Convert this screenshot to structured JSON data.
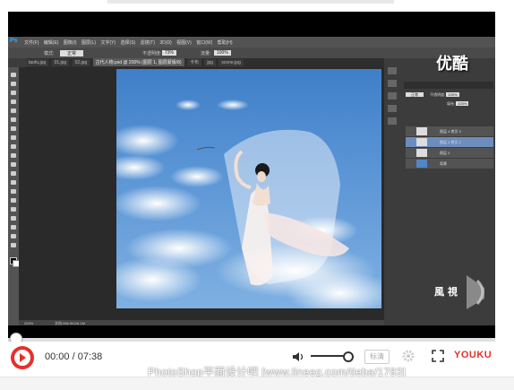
{
  "photoshop": {
    "logo": "Ps",
    "menu": [
      "文件(F)",
      "编辑(E)",
      "图像(I)",
      "图层(L)",
      "文字(Y)",
      "选择(S)",
      "滤镜(T)",
      "3D(D)",
      "视图(V)",
      "窗口(W)",
      "帮助(H)"
    ],
    "options": {
      "mode_label": "模式:",
      "mode_value": "正常",
      "opacity_label": "不透明度:",
      "opacity_value": "73%",
      "flow_label": "流量:",
      "flow_value": "100%"
    },
    "tabs": [
      "taofu.jpg",
      "01.jpg",
      "02.jpg",
      "古代人物.psd @ 200% (图层 1, 图层蒙版/8)",
      "卡布",
      "jpg",
      "scene.jpg"
    ],
    "active_tab_index": 3,
    "status": {
      "zoom": "200%",
      "doc": "文档:958.9K/16.1M"
    },
    "layers": [
      {
        "name": "图层 4 拷贝 3",
        "selected": false
      },
      {
        "name": "图层 4 拷贝 2",
        "selected": true
      },
      {
        "name": "图层 3",
        "selected": false
      },
      {
        "name": "背景",
        "selected": false
      }
    ],
    "layers_mode": "正常",
    "layers_opacity_label": "不透明度:",
    "layers_opacity": "100%",
    "layers_fill_label": "填充:",
    "layers_fill": "100%"
  },
  "player": {
    "brand_overlay": "优酷",
    "watermark_text": "風 視",
    "current_time": "00:00",
    "total_time": "07:38",
    "time_separator": " / ",
    "quality_label": "标清",
    "logo": "YOUKU",
    "progress": 0.0,
    "volume": 0.85
  },
  "footer": {
    "text": "PhotoShop平面设计吧 [www.lineeg.com/tieba/1783]"
  },
  "colors": {
    "accent": "#e6302b",
    "ps_blue": "#31a8ff"
  }
}
